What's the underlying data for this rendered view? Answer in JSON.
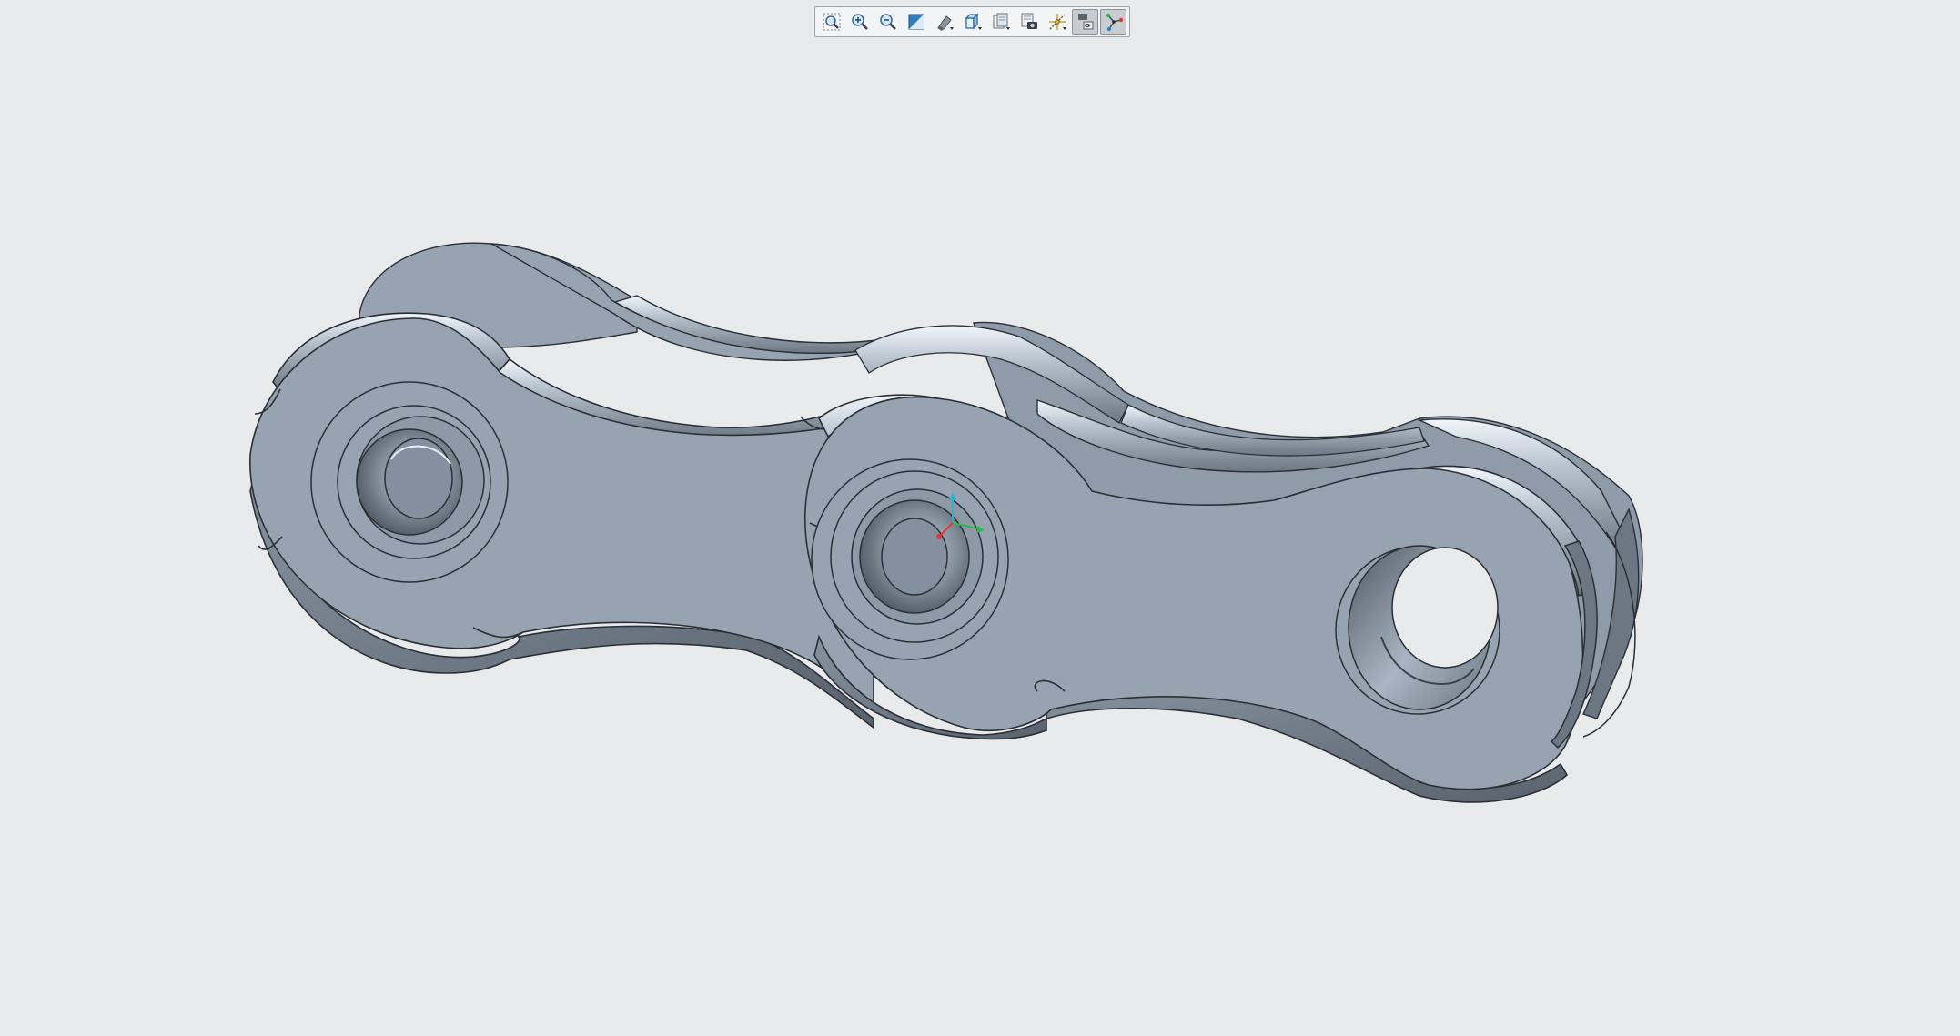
{
  "app": {
    "background": "#e9eaec"
  },
  "toolbar": {
    "buttons": [
      {
        "name": "zoom-fit-button",
        "icon": "zoom-fit-icon",
        "active": false
      },
      {
        "name": "zoom-in-button",
        "icon": "zoom-in-icon",
        "active": false
      },
      {
        "name": "zoom-out-button",
        "icon": "zoom-out-icon",
        "active": false
      },
      {
        "name": "view-orient-button",
        "icon": "view-orient-icon",
        "active": false
      },
      {
        "name": "display-style-button",
        "icon": "display-style-icon",
        "active": false
      },
      {
        "name": "saved-views-button",
        "icon": "cube-view-icon",
        "active": false
      },
      {
        "name": "section-view-button",
        "icon": "section-view-icon",
        "active": false
      },
      {
        "name": "screenshot-button",
        "icon": "camera-icon",
        "active": false
      },
      {
        "name": "datum-display-button",
        "icon": "datum-icon",
        "active": false
      },
      {
        "name": "annotation-display-button",
        "icon": "annotation-icon",
        "active": true
      },
      {
        "name": "spin-center-button",
        "icon": "spin-center-icon",
        "active": true
      }
    ]
  },
  "model": {
    "name": "chain-link-assembly",
    "colors": {
      "face": "#97a3b0",
      "edge": "#2a2f36",
      "highlight": "#e8eef5",
      "shadow": "#5b6470"
    }
  },
  "triad": {
    "x_color": "#e03a2f",
    "y_color": "#2fb84c",
    "z_color": "#2ab3c9"
  }
}
